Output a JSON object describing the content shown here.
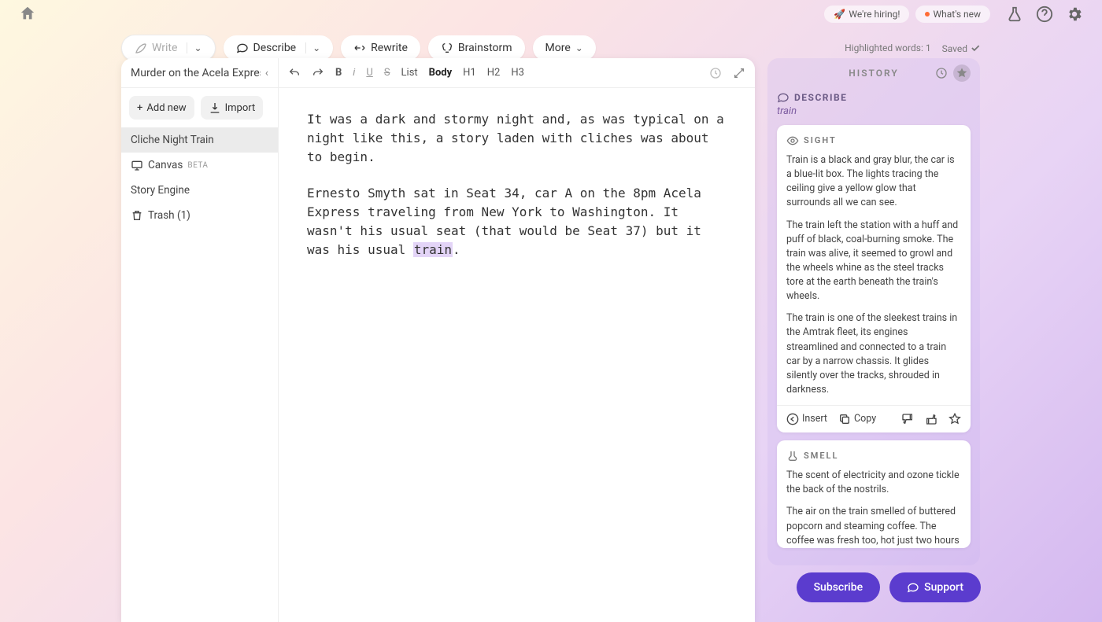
{
  "header": {
    "hiring": "We're hiring!",
    "whatsnew": "What's new"
  },
  "tools": {
    "write": "Write",
    "describe": "Describe",
    "rewrite": "Rewrite",
    "brainstorm": "Brainstorm",
    "more": "More"
  },
  "status": {
    "highlighted": "Highlighted words: 1",
    "saved": "Saved"
  },
  "doc": {
    "title": "Murder on the Acela Expres",
    "actions": {
      "addnew": "Add new",
      "import": "Import"
    },
    "items": {
      "cliche": "Cliche Night Train",
      "canvas": "Canvas",
      "beta": "BETA",
      "story": "Story Engine",
      "trash": "Trash (1)"
    }
  },
  "toolbar": {
    "b": "B",
    "i": "i",
    "u": "U",
    "s": "S",
    "list": "List",
    "body": "Body",
    "h1": "H1",
    "h2": "H2",
    "h3": "H3"
  },
  "content": {
    "p1": "It was a dark and stormy night and, as was typical on a night like this, a story laden with cliches was about to begin.",
    "p2a": "Ernesto Smyth sat in Seat 34, car A on the 8pm Acela Express traveling from New York to Washington. It wasn't his usual seat (that would be Seat 37) but it was his usual ",
    "p2_highlight": "train",
    "p2b": "."
  },
  "history": {
    "title": "HISTORY",
    "describe_label": "DESCRIBE",
    "describe_term": "train",
    "sight": {
      "label": "SIGHT",
      "p1": "Train is a black and gray blur, the car is a blue-lit box. The lights tracing the ceiling give a yellow glow that surrounds all we can see.",
      "p2": "The train left the station with a huff and puff of black, coal-burning smoke. The train was alive, it seemed to growl and the wheels whine as the steel tracks tore at the earth beneath the train's wheels.",
      "p3": "The train is one of the sleekest trains in the Amtrak fleet, its engines streamlined and connected to a train car by a narrow chassis. It glides silently over the tracks, shrouded in darkness."
    },
    "actions": {
      "insert": "Insert",
      "copy": "Copy"
    },
    "smell": {
      "label": "SMELL",
      "p1": "The scent of electricity and ozone tickle the back of the nostrils.",
      "p2": "The air on the train smelled of buttered popcorn and steaming coffee. The coffee was fresh too, hot just two hours ago and still giving off a hint of that"
    }
  },
  "bottom": {
    "subscribe": "Subscribe",
    "support": "Support"
  }
}
